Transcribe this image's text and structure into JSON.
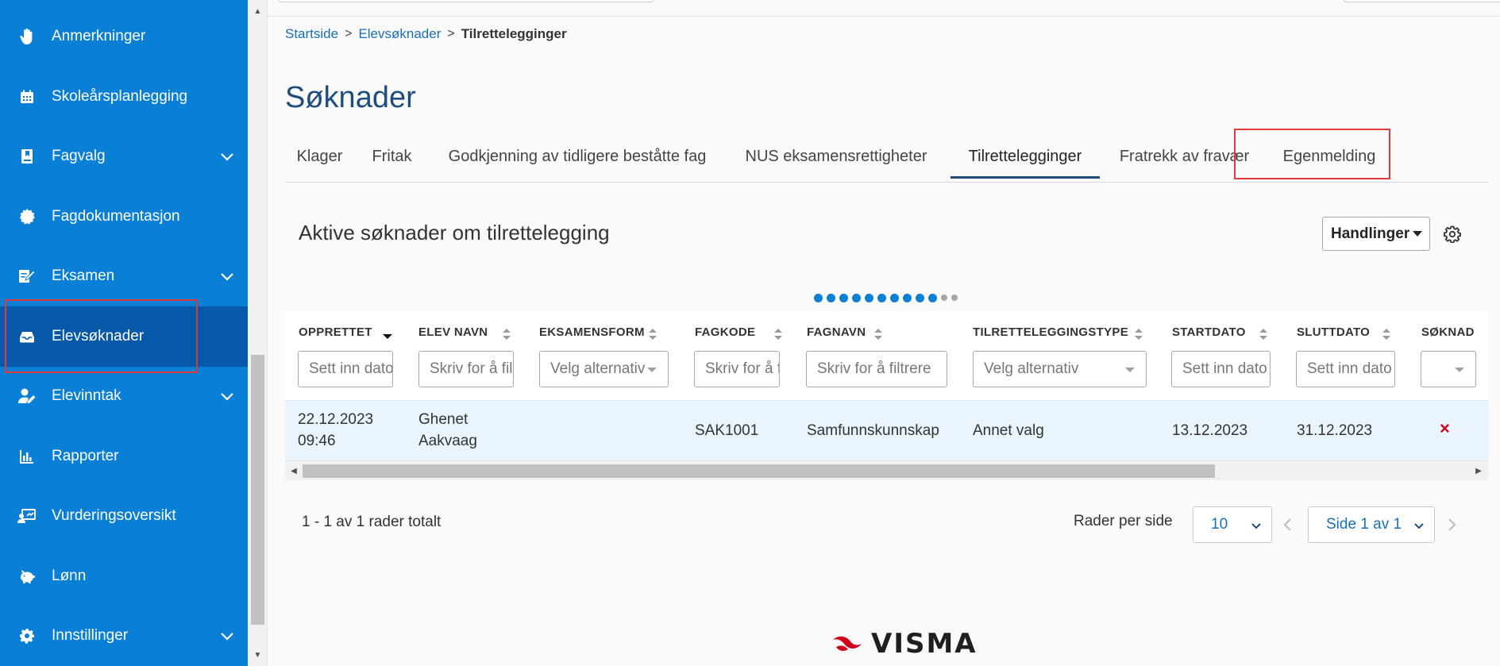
{
  "sidebar": {
    "items": [
      {
        "label": "Anmerkninger",
        "icon": "hand-icon",
        "chevron": false,
        "active": false
      },
      {
        "label": "Skoleårsplanlegging",
        "icon": "calendar-icon",
        "chevron": false,
        "active": false
      },
      {
        "label": "Fagvalg",
        "icon": "bookmark-icon",
        "chevron": true,
        "active": false
      },
      {
        "label": "Fagdokumentasjon",
        "icon": "badge-icon",
        "chevron": false,
        "active": false
      },
      {
        "label": "Eksamen",
        "icon": "edit-document-icon",
        "chevron": true,
        "active": false
      },
      {
        "label": "Elevsøknader",
        "icon": "inbox-icon",
        "chevron": false,
        "active": true
      },
      {
        "label": "Elevinntak",
        "icon": "user-edit-icon",
        "chevron": true,
        "active": false
      },
      {
        "label": "Rapporter",
        "icon": "bar-chart-icon",
        "chevron": false,
        "active": false
      },
      {
        "label": "Vurderingsoversikt",
        "icon": "assessment-icon",
        "chevron": false,
        "active": false
      },
      {
        "label": "Lønn",
        "icon": "piggy-bank-icon",
        "chevron": false,
        "active": false
      },
      {
        "label": "Innstillinger",
        "icon": "gear-icon",
        "chevron": true,
        "active": false
      }
    ]
  },
  "breadcrumb": {
    "home": "Startside",
    "parent": "Elevsøknader",
    "current": "Tilrettelegginger"
  },
  "page": {
    "title": "Søknader"
  },
  "tabs": [
    {
      "label": "Klager"
    },
    {
      "label": "Fritak"
    },
    {
      "label": "Godkjenning av tidligere beståtte fag"
    },
    {
      "label": "NUS eksamensrettigheter"
    },
    {
      "label": "Tilrettelegginger"
    },
    {
      "label": "Fratrekk av fravær"
    },
    {
      "label": "Egenmelding"
    }
  ],
  "section": {
    "title": "Aktive søknader om tilrettelegging",
    "actions_label": "Handlinger"
  },
  "table": {
    "columns": [
      {
        "header": "OPPRETTET",
        "filter": "Sett inn dato"
      },
      {
        "header": "ELEV NAVN",
        "filter": "Skriv for å filtrere"
      },
      {
        "header": "EKSAMENSFORM",
        "filter": "Velg alternativ"
      },
      {
        "header": "FAGKODE",
        "filter": "Skriv for å filtrere"
      },
      {
        "header": "FAGNAVN",
        "filter": "Skriv for å filtrere"
      },
      {
        "header": "TILRETTELEGGINGSTYPE",
        "filter": "Velg alternativ"
      },
      {
        "header": "STARTDATO",
        "filter": "Sett inn dato"
      },
      {
        "header": "SLUTTDATO",
        "filter": "Sett inn dato"
      },
      {
        "header": "SØKNAD",
        "filter": ""
      }
    ],
    "rows": [
      {
        "opprettet_date": "22.12.2023",
        "opprettet_time": "09:46",
        "elev_first": "Ghenet",
        "elev_last": "Aakvaag",
        "eksamensform": "",
        "fagkode": "SAK1001",
        "fagnavn": "Samfunnskunnskap",
        "type": "Annet valg",
        "startdato": "13.12.2023",
        "sluttdato": "31.12.2023",
        "soknad_mark": "×"
      }
    ]
  },
  "pagination": {
    "total_text": "1 - 1 av 1 rader totalt",
    "rows_per_page_label": "Rader per side",
    "rows_per_page": "10",
    "page_label": "Side 1 av 1"
  },
  "footer": {
    "logo_text": "VISMA"
  },
  "colors": {
    "sidebar": "#0a7fd6",
    "sidebar_active": "#0659a8",
    "highlight": "#e0393e",
    "title": "#1f4d80",
    "link": "#1a6fb8",
    "logo_red": "#d0021b"
  }
}
